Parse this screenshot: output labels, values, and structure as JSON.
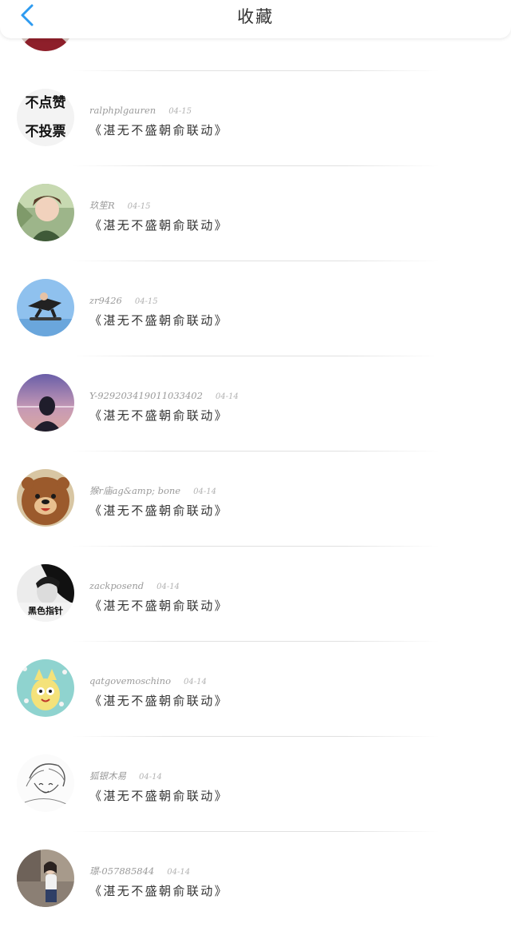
{
  "header": {
    "title": "收藏",
    "back_icon": "chevron-left-icon",
    "accent": "#2e9bf0"
  },
  "items": [
    {
      "username": "",
      "date": "",
      "content": "",
      "avatar": "red-portrait"
    },
    {
      "username": "ralphplgauren",
      "date": "04-15",
      "content": "《湛无不盛朝俞联动》",
      "avatar": "text-avatar",
      "avatar_lines": [
        "不点赞",
        "不投票"
      ]
    },
    {
      "username": "玖笙R",
      "date": "04-15",
      "content": "《湛无不盛朝俞联动》",
      "avatar": "anime-boy"
    },
    {
      "username": "zr9426",
      "date": "04-15",
      "content": "《湛无不盛朝俞联动》",
      "avatar": "skateboarder"
    },
    {
      "username": "Y-929203419011033402",
      "date": "04-14",
      "content": "《湛无不盛朝俞联动》",
      "avatar": "girl-sunset"
    },
    {
      "username": "猴r庙ag&amp; bone",
      "date": "04-14",
      "content": "《湛无不盛朝俞联动》",
      "avatar": "brown-bear"
    },
    {
      "username": "zackposend",
      "date": "04-14",
      "content": "《湛无不盛朝俞联动》",
      "avatar": "bw-portrait",
      "avatar_caption": "黑色指针"
    },
    {
      "username": "qatgovemoschino",
      "date": "04-14",
      "content": "《湛无不盛朝俞联动》",
      "avatar": "cartoon-cat"
    },
    {
      "username": "狐银木易",
      "date": "04-14",
      "content": "《湛无不盛朝俞联动》",
      "avatar": "manga-sketch"
    },
    {
      "username": "璟-057885844",
      "date": "04-14",
      "content": "《湛无不盛朝俞联动》",
      "avatar": "street-photo"
    }
  ]
}
